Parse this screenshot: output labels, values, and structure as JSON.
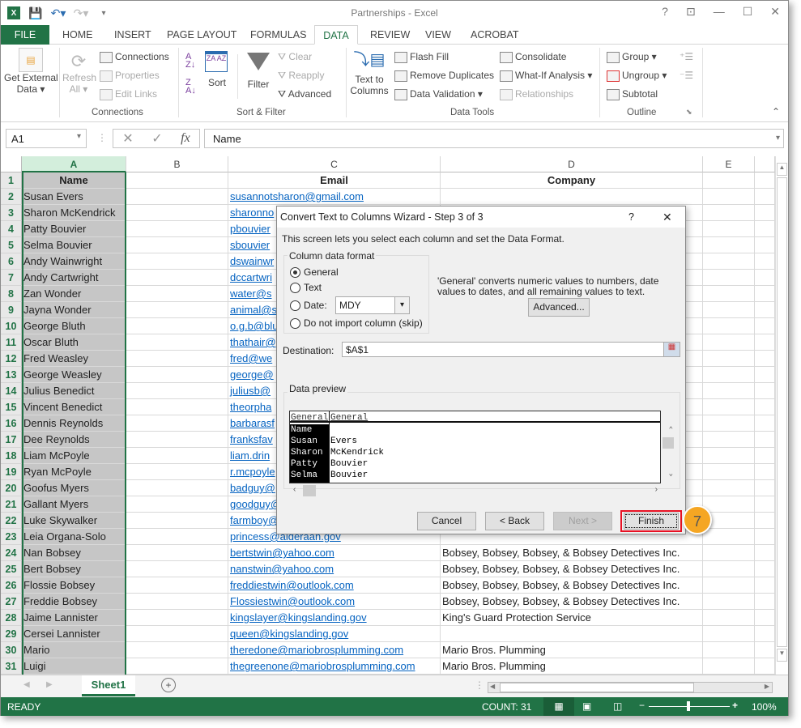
{
  "app": {
    "title": "Partnerships - Excel",
    "window_controls": [
      "?",
      "restore-ribbon",
      "minimize",
      "maximize",
      "close"
    ]
  },
  "tabs": [
    {
      "label": "FILE"
    },
    {
      "label": "HOME"
    },
    {
      "label": "INSERT"
    },
    {
      "label": "PAGE LAYOUT"
    },
    {
      "label": "FORMULAS"
    },
    {
      "label": "DATA",
      "active": true
    },
    {
      "label": "REVIEW"
    },
    {
      "label": "VIEW"
    },
    {
      "label": "ACROBAT"
    }
  ],
  "ribbon": {
    "get_external": {
      "line1": "Get External",
      "line2": "Data ▾"
    },
    "refresh": {
      "line1": "Refresh",
      "line2": "All ▾"
    },
    "connections": "Connections",
    "properties": "Properties",
    "edit_links": "Edit Links",
    "group_connections": "Connections",
    "sort": "Sort",
    "filter": "Filter",
    "clear": "Clear",
    "reapply": "Reapply",
    "advanced": "Advanced",
    "group_sort": "Sort & Filter",
    "text_to_columns": {
      "line1": "Text to",
      "line2": "Columns"
    },
    "flash_fill": "Flash Fill",
    "remove_duplicates": "Remove Duplicates",
    "data_validation": "Data Validation ▾",
    "consolidate": "Consolidate",
    "what_if": "What-If Analysis ▾",
    "relationships": "Relationships",
    "group_tools": "Data Tools",
    "group": "Group ▾",
    "ungroup": "Ungroup ▾",
    "subtotal": "Subtotal",
    "group_outline": "Outline"
  },
  "formula_bar": {
    "name_box": "A1",
    "formula": "Name"
  },
  "columns": [
    "A",
    "B",
    "C",
    "D",
    "E"
  ],
  "rows": [
    {
      "n": "1",
      "name": "Name",
      "email": "Email",
      "company": "Company"
    },
    {
      "n": "2",
      "name": "Susan Evers",
      "email": "susannotsharon@gmail.com",
      "company": ""
    },
    {
      "n": "3",
      "name": "Sharon McKendrick",
      "email": "sharonno",
      "company": ""
    },
    {
      "n": "4",
      "name": "Patty Bouvier",
      "email": "pbouvier",
      "company": ""
    },
    {
      "n": "5",
      "name": "Selma Bouvier",
      "email": "sbouvier",
      "company": ""
    },
    {
      "n": "6",
      "name": "Andy Wainwright",
      "email": "dswainwr",
      "company": ""
    },
    {
      "n": "7",
      "name": "Andy Cartwright",
      "email": "dccartwri",
      "company": ""
    },
    {
      "n": "8",
      "name": "Zan Wonder",
      "email": "water@s",
      "company": ""
    },
    {
      "n": "9",
      "name": "Jayna Wonder",
      "email": "animal@s",
      "company": ""
    },
    {
      "n": "10",
      "name": "George Bluth",
      "email": "o.g.b@blu",
      "company": ""
    },
    {
      "n": "11",
      "name": "Oscar Bluth",
      "email": "thathair@",
      "company": ""
    },
    {
      "n": "12",
      "name": "Fred Weasley",
      "email": "fred@we",
      "company": ""
    },
    {
      "n": "13",
      "name": "George Weasley",
      "email": "george@",
      "company": ""
    },
    {
      "n": "14",
      "name": "Julius Benedict",
      "email": "juliusb@",
      "company": ""
    },
    {
      "n": "15",
      "name": "Vincent Benedict",
      "email": "theorpha",
      "company": ""
    },
    {
      "n": "16",
      "name": "Dennis Reynolds",
      "email": "barbarasf",
      "company": ""
    },
    {
      "n": "17",
      "name": "Dee Reynolds",
      "email": "franksfav",
      "company": ""
    },
    {
      "n": "18",
      "name": "Liam McPoyle",
      "email": "liam.drin",
      "company": ""
    },
    {
      "n": "19",
      "name": "Ryan McPoyle",
      "email": "r.mcpoyle",
      "company": ""
    },
    {
      "n": "20",
      "name": "Goofus Myers",
      "email": "badguy@",
      "company": ""
    },
    {
      "n": "21",
      "name": "Gallant Myers",
      "email": "goodguy@",
      "company": ""
    },
    {
      "n": "22",
      "name": "Luke Skywalker",
      "email": "farmboy@",
      "company": ""
    },
    {
      "n": "23",
      "name": "Leia Organa-Solo",
      "email": "princess@alderaan.gov",
      "company": ""
    },
    {
      "n": "24",
      "name": "Nan Bobsey",
      "email": "bertstwin@yahoo.com",
      "company": "Bobsey, Bobsey, Bobsey, & Bobsey Detectives Inc."
    },
    {
      "n": "25",
      "name": "Bert Bobsey",
      "email": "nanstwin@yahoo.com",
      "company": "Bobsey, Bobsey, Bobsey, & Bobsey Detectives Inc."
    },
    {
      "n": "26",
      "name": "Flossie Bobsey",
      "email": "freddiestwin@outlook.com",
      "company": "Bobsey, Bobsey, Bobsey, & Bobsey Detectives Inc."
    },
    {
      "n": "27",
      "name": "Freddie Bobsey",
      "email": "Flossiestwin@outlook.com",
      "company": "Bobsey, Bobsey, Bobsey, & Bobsey Detectives Inc."
    },
    {
      "n": "28",
      "name": "Jaime Lannister",
      "email": "kingslayer@kingslanding.gov",
      "company": "King's Guard Protection Service"
    },
    {
      "n": "29",
      "name": "Cersei Lannister",
      "email": "queen@kingslanding.gov",
      "company": ""
    },
    {
      "n": "30",
      "name": "Mario",
      "email": "theredone@mariobrosplumming.com",
      "company": "Mario Bros. Plumming"
    },
    {
      "n": "31",
      "name": "Luigi",
      "email": "thegreenone@mariobrosplumming.com",
      "company": "Mario Bros. Plumming"
    }
  ],
  "sheet_tab": "Sheet1",
  "status": {
    "ready": "READY",
    "count": "COUNT: 31",
    "zoom": "100%",
    "zoom_level": 100
  },
  "dialog": {
    "title": "Convert Text to Columns Wizard - Step 3 of 3",
    "help": "?",
    "close": "✕",
    "intro": "This screen lets you select each column and set the Data Format.",
    "fieldset_label": "Column data format",
    "options": [
      "General",
      "Text",
      "Date:",
      "Do not import column (skip)"
    ],
    "selected_option": "General",
    "date_format": "MDY",
    "description": "'General' converts numeric values to numbers, date values to dates, and all remaining values to text.",
    "advanced": "Advanced...",
    "destination_label": "Destination:",
    "destination_value": "$A$1",
    "preview_label": "Data preview",
    "preview_headers": [
      "General",
      "General"
    ],
    "preview_rows": [
      [
        "Name",
        ""
      ],
      [
        "Susan",
        "Evers"
      ],
      [
        "Sharon",
        "McKendrick"
      ],
      [
        "Patty",
        "Bouvier"
      ],
      [
        "Selma",
        "Bouvier"
      ]
    ],
    "buttons": {
      "cancel": "Cancel",
      "back": "< Back",
      "next": "Next >",
      "finish": "Finish"
    }
  },
  "callout": {
    "step": "7",
    "color": "#f5a623"
  },
  "colors": {
    "excel_green": "#217346",
    "link": "#0563c1",
    "highlight": "#e81123"
  }
}
